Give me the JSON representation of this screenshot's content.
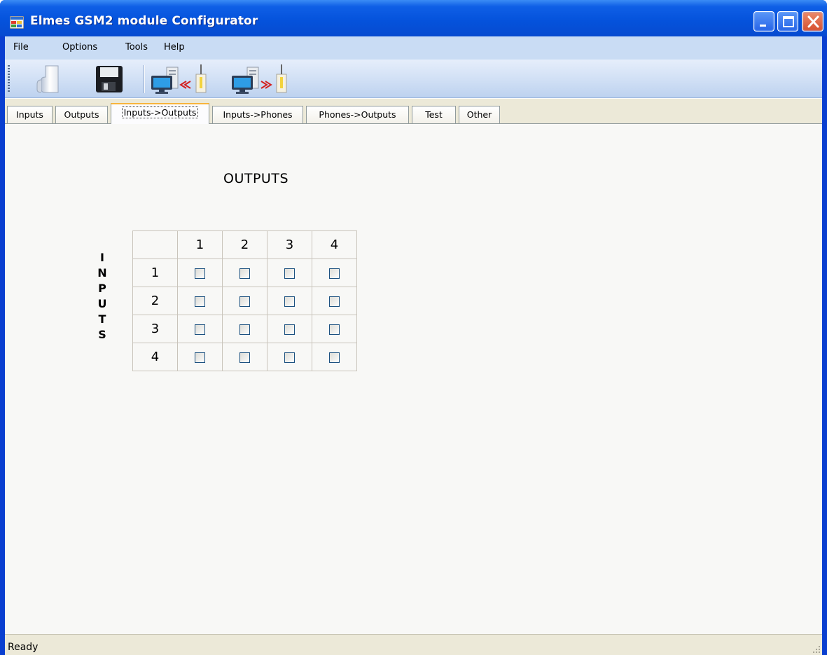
{
  "window": {
    "title": "Elmes GSM2 module Configurator",
    "controls": [
      "minimize-icon",
      "maximize-icon",
      "close-icon"
    ]
  },
  "menu": {
    "items": [
      "File",
      "Options",
      "Tools",
      "Help"
    ]
  },
  "toolbar": {
    "buttons": [
      "open-icon",
      "save-icon",
      "read-from-device-icon",
      "write-to-device-icon"
    ]
  },
  "tabs": {
    "items": [
      "Inputs",
      "Outputs",
      "Inputs->Outputs",
      "Inputs->Phones",
      "Phones->Outputs",
      "Test",
      "Other"
    ],
    "selected": "Inputs->Outputs"
  },
  "matrix": {
    "outputs_caption": "OUTPUTS",
    "inputs_caption": [
      "I",
      "N",
      "P",
      "U",
      "T",
      "S"
    ],
    "column_headers": [
      "1",
      "2",
      "3",
      "4"
    ],
    "row_headers": [
      "1",
      "2",
      "3",
      "4"
    ],
    "checked": [
      [
        false,
        false,
        false,
        false
      ],
      [
        false,
        false,
        false,
        false
      ],
      [
        false,
        false,
        false,
        false
      ],
      [
        false,
        false,
        false,
        false
      ]
    ]
  },
  "status": {
    "text": "Ready"
  },
  "colors": {
    "titlebar": "#0553dc",
    "menubar": "#c9dcf4",
    "tab_active_accent": "#f7b43c",
    "checkbox_border": "#1c5180"
  }
}
